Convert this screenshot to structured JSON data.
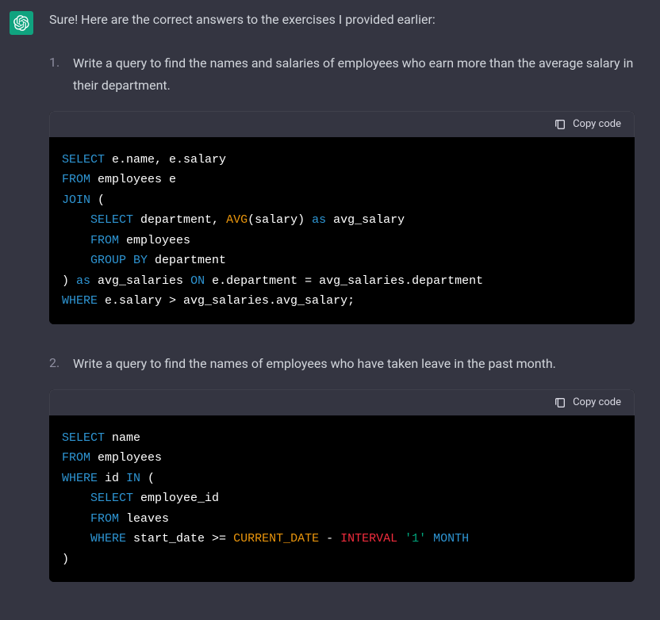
{
  "intro": "Sure! Here are the correct answers to the exercises I provided earlier:",
  "items": [
    {
      "number": "1.",
      "text": "Write a query to find the names and salaries of employees who earn more than the average salary in their department."
    },
    {
      "number": "2.",
      "text": "Write a query to find the names of employees who have taken leave in the past month."
    }
  ],
  "copy_label": "Copy code",
  "code1": {
    "l1_select": "SELECT",
    "l1_rest": " e.name, e.salary",
    "l2_from": "FROM",
    "l2_rest": " employees e",
    "l3_join": "JOIN",
    "l3_rest": " (",
    "l4_indent": "    ",
    "l4_select": "SELECT",
    "l4_rest1": " department, ",
    "l4_avg": "AVG",
    "l4_rest2": "(salary) ",
    "l4_as": "as",
    "l4_rest3": " avg_salary",
    "l5_indent": "    ",
    "l5_from": "FROM",
    "l5_rest": " employees",
    "l6_indent": "    ",
    "l6_group": "GROUP",
    "l6_by": " BY",
    "l6_rest": " department",
    "l7_paren": ") ",
    "l7_as": "as",
    "l7_rest1": " avg_salaries ",
    "l7_on": "ON",
    "l7_rest2": " e.department = avg_salaries.department",
    "l8_where": "WHERE",
    "l8_rest": " e.salary > avg_salaries.avg_salary;"
  },
  "code2": {
    "l1_select": "SELECT",
    "l1_rest": " name",
    "l2_from": "FROM",
    "l2_rest": " employees",
    "l3_where": "WHERE",
    "l3_rest1": " id ",
    "l3_in": "IN",
    "l3_rest2": " (",
    "l4_indent": "    ",
    "l4_select": "SELECT",
    "l4_rest": " employee_id",
    "l5_indent": "    ",
    "l5_from": "FROM",
    "l5_rest": " leaves",
    "l6_indent": "    ",
    "l6_where": "WHERE",
    "l6_rest1": " start_date >= ",
    "l6_current": "CURRENT_DATE",
    "l6_rest2": " - ",
    "l6_interval": "INTERVAL",
    "l6_rest3": " ",
    "l6_str": "'1'",
    "l6_rest4": " ",
    "l6_month": "MONTH",
    "l7_paren": ")"
  }
}
